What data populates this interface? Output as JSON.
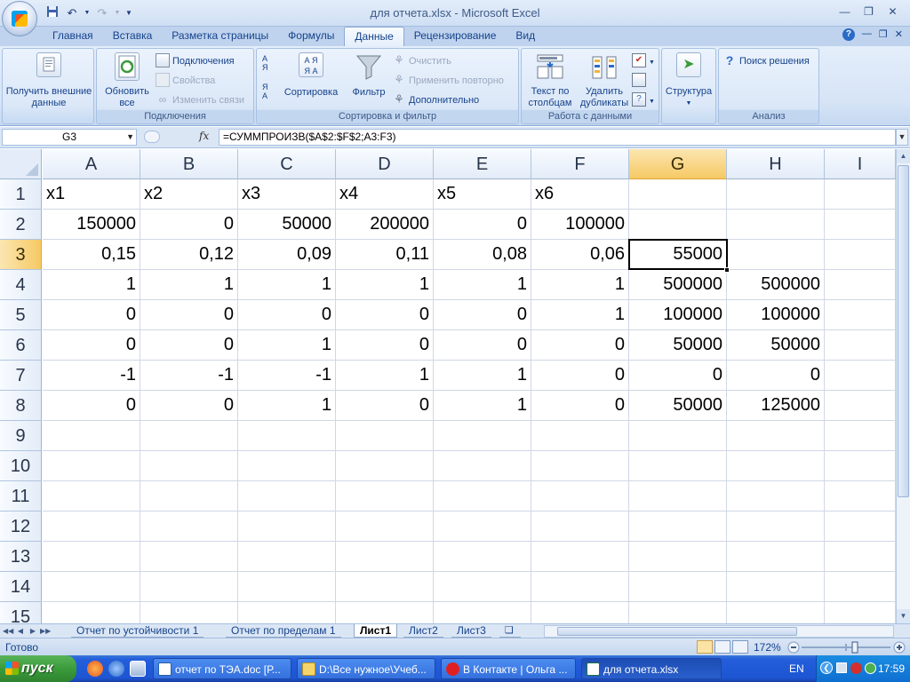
{
  "window": {
    "title": "для отчета.xlsx - Microsoft Excel"
  },
  "colors": {
    "ribbon_bg": "#dbe6f5",
    "selected_header": "#f6c964",
    "taskbar": "#245edb",
    "start": "#3a9b3a"
  },
  "ribbon": {
    "tabs": [
      "Главная",
      "Вставка",
      "Разметка страницы",
      "Формулы",
      "Данные",
      "Рецензирование",
      "Вид"
    ],
    "active_tab": "Данные",
    "groups": {
      "external": {
        "button": "Получить внешние данные"
      },
      "connections": {
        "refresh": "Обновить все",
        "connections": "Подключения",
        "properties": "Свойства",
        "edit_links": "Изменить связи",
        "label": "Подключения"
      },
      "sortfilter": {
        "sort": "Сортировка",
        "filter": "Фильтр",
        "clear": "Очистить",
        "reapply": "Применить повторно",
        "advanced": "Дополнительно",
        "label": "Сортировка и фильтр"
      },
      "datatools": {
        "text_to_columns": "Текст по столбцам",
        "remove_duplicates": "Удалить дубликаты",
        "label": "Работа с данными"
      },
      "outline": {
        "button": "Структура"
      },
      "analysis": {
        "solver": "Поиск решения",
        "label": "Анализ"
      }
    }
  },
  "formula_bar": {
    "name_box": "G3",
    "fx": "fx",
    "formula": "=СУММПРОИЗВ($A$2:$F$2;A3:F3)"
  },
  "grid": {
    "columns": [
      "A",
      "B",
      "C",
      "D",
      "E",
      "F",
      "G",
      "H",
      "I"
    ],
    "selected_column": "G",
    "rows": [
      "1",
      "2",
      "3",
      "4",
      "5",
      "6",
      "7",
      "8",
      "9",
      "10",
      "11",
      "12",
      "13",
      "14",
      "15"
    ],
    "selected_row": "3",
    "cells": [
      [
        "x1",
        "x2",
        "x3",
        "x4",
        "x5",
        "x6",
        "",
        "",
        ""
      ],
      [
        "150000",
        "0",
        "50000",
        "200000",
        "0",
        "100000",
        "",
        "",
        ""
      ],
      [
        "0,15",
        "0,12",
        "0,09",
        "0,11",
        "0,08",
        "0,06",
        "55000",
        "",
        ""
      ],
      [
        "1",
        "1",
        "1",
        "1",
        "1",
        "1",
        "500000",
        "500000",
        ""
      ],
      [
        "0",
        "0",
        "0",
        "0",
        "0",
        "1",
        "100000",
        "100000",
        ""
      ],
      [
        "0",
        "0",
        "1",
        "0",
        "0",
        "0",
        "50000",
        "50000",
        ""
      ],
      [
        "-1",
        "-1",
        "-1",
        "1",
        "1",
        "0",
        "0",
        "0",
        ""
      ],
      [
        "0",
        "0",
        "1",
        "0",
        "1",
        "0",
        "50000",
        "125000",
        ""
      ]
    ]
  },
  "sheets": {
    "tabs": [
      "Отчет по устойчивости 1",
      "Отчет по пределам 1",
      "Лист1",
      "Лист2",
      "Лист3"
    ],
    "active": "Лист1"
  },
  "status": {
    "text": "Готово",
    "zoom": "172%"
  },
  "taskbar": {
    "start": "пуск",
    "buttons": [
      "отчет по ТЭА.doc [Р...",
      "D:\\Все нужное\\Учеб...",
      "В Контакте | Ольга ...",
      "для отчета.xlsx"
    ],
    "active_button": 3,
    "language": "EN",
    "clock": "17:59"
  }
}
